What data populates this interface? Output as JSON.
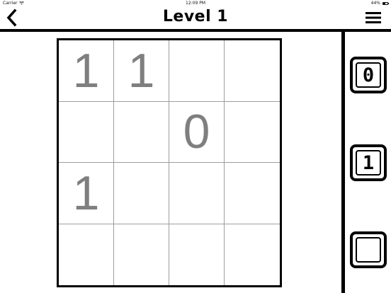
{
  "status_bar": {
    "carrier": "Carrier",
    "time": "12:09 PM",
    "battery": "44%",
    "battery_level": 0.44
  },
  "header": {
    "title": "Level 1",
    "back_icon": "chevron-left-icon",
    "menu_icon": "hamburger-menu-icon"
  },
  "board": {
    "rows": [
      [
        "1",
        "1",
        "",
        ""
      ],
      [
        "",
        "",
        "0",
        ""
      ],
      [
        "1",
        "",
        "",
        ""
      ],
      [
        "",
        "",
        "",
        ""
      ]
    ]
  },
  "choices": [
    {
      "label": "0"
    },
    {
      "label": "1"
    },
    {
      "label": ""
    }
  ],
  "colors": {
    "clue_text": "#7f7f7f",
    "grid_lines": "#9e9e9e",
    "border": "#000000"
  }
}
